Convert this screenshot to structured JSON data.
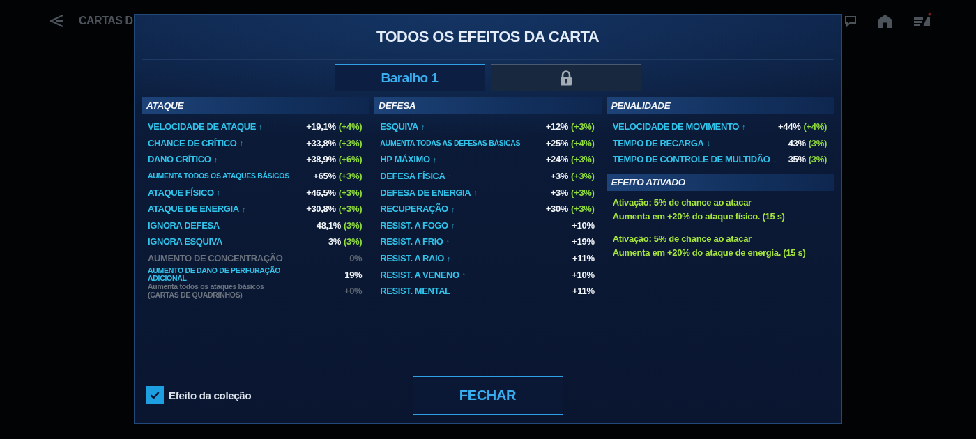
{
  "background": {
    "title": "CARTAS D"
  },
  "dialog": {
    "title": "TODOS OS EFEITOS DA CARTA",
    "tabs": [
      {
        "label": "Baralho 1",
        "selected": true,
        "locked": false
      },
      {
        "selected": false,
        "locked": true
      }
    ],
    "columns": [
      {
        "sections": [
          {
            "kind": "stats",
            "title": "ATAQUE",
            "stats": [
              {
                "label": "VELOCIDADE DE ATAQUE",
                "arrow": "↑",
                "value": "+19,1%",
                "bonus": "(+4%)",
                "kind": "regular",
                "disabled": false
              },
              {
                "label": "CHANCE DE CRÍTICO",
                "arrow": "↑",
                "value": "+33,8%",
                "bonus": "(+3%)",
                "kind": "regular",
                "disabled": false
              },
              {
                "label": "DANO CRÍTICO",
                "arrow": "↑",
                "value": "+38,9%",
                "bonus": "(+6%)",
                "kind": "regular",
                "disabled": false
              },
              {
                "label": "AUMENTA TODOS OS ATAQUES BÁSICOS",
                "value": "+65%",
                "bonus": "(+3%)",
                "kind": "compact",
                "disabled": false
              },
              {
                "label": "ATAQUE FÍSICO",
                "arrow": "↑",
                "value": "+46,5%",
                "bonus": "(+3%)",
                "kind": "regular",
                "disabled": false
              },
              {
                "label": "ATAQUE DE ENERGIA",
                "arrow": "↑",
                "value": "+30,8%",
                "bonus": "(+3%)",
                "kind": "regular",
                "disabled": false
              },
              {
                "label": "IGNORA DEFESA",
                "value": "48,1%",
                "bonus": "(3%)",
                "kind": "regular",
                "disabled": false
              },
              {
                "label": "IGNORA ESQUIVA",
                "value": "3%",
                "bonus": "(3%)",
                "kind": "regular",
                "disabled": false
              },
              {
                "label": "AUMENTO DE CONCENTRAÇÃO",
                "value": "0%",
                "kind": "regular",
                "disabled": true
              },
              {
                "label": "AUMENTO DE DANO DE PERFURAÇÃO ADICIONAL",
                "value": "19%",
                "kind": "compact",
                "disabled": false
              },
              {
                "label": "Aumenta todos os ataques básicos (CARTAS DE QUADRINHOS)",
                "value": "+0%",
                "kind": "compact",
                "disabled": true
              }
            ]
          }
        ]
      },
      {
        "sections": [
          {
            "kind": "stats",
            "title": "DEFESA",
            "stats": [
              {
                "label": "ESQUIVA",
                "arrow": "↑",
                "value": "+12%",
                "bonus": "(+3%)",
                "kind": "regular",
                "disabled": false
              },
              {
                "label": "AUMENTA TODAS AS DEFESAS BÁSICAS",
                "value": "+25%",
                "bonus": "(+4%)",
                "kind": "compact",
                "disabled": false
              },
              {
                "label": "HP MÁXIMO",
                "arrow": "↑",
                "value": "+24%",
                "bonus": "(+3%)",
                "kind": "regular",
                "disabled": false
              },
              {
                "label": "DEFESA FÍSICA",
                "arrow": "↑",
                "value": "+3%",
                "bonus": "(+3%)",
                "kind": "regular",
                "disabled": false
              },
              {
                "label": "DEFESA DE ENERGIA",
                "arrow": "↑",
                "value": "+3%",
                "bonus": "(+3%)",
                "kind": "regular",
                "disabled": false
              },
              {
                "label": "RECUPERAÇÃO",
                "arrow": "↑",
                "value": "+30%",
                "bonus": "(+3%)",
                "kind": "regular",
                "disabled": false
              },
              {
                "label": "RESIST. A FOGO",
                "arrow": "↑",
                "value": "+10%",
                "kind": "regular",
                "disabled": false
              },
              {
                "label": "RESIST. A FRIO",
                "arrow": "↑",
                "value": "+19%",
                "kind": "regular",
                "disabled": false
              },
              {
                "label": "RESIST. A RAIO",
                "arrow": "↑",
                "value": "+11%",
                "kind": "regular",
                "disabled": false
              },
              {
                "label": "RESIST. A VENENO",
                "arrow": "↑",
                "value": "+10%",
                "kind": "regular",
                "disabled": false
              },
              {
                "label": "RESIST. MENTAL",
                "arrow": "↑",
                "value": "+11%",
                "kind": "regular",
                "disabled": false
              }
            ]
          }
        ]
      },
      {
        "sections": [
          {
            "kind": "stats",
            "title": "PENALIDADE",
            "stats": [
              {
                "label": "VELOCIDADE DE MOVIMENTO",
                "arrow": "↑",
                "value": "+44%",
                "bonus": "(+4%)",
                "kind": "regular",
                "disabled": false
              },
              {
                "label": "TEMPO DE RECARGA",
                "arrow": "↓",
                "value": "43%",
                "bonus": "(3%)",
                "kind": "regular",
                "disabled": false
              },
              {
                "label": "TEMPO DE CONTROLE DE MULTIDÃO",
                "arrow": "↓",
                "value": "35%",
                "bonus": "(3%)",
                "kind": "regular",
                "disabled": false
              }
            ]
          },
          {
            "kind": "effects",
            "title": "EFEITO ATIVADO",
            "effects": [
              {
                "trigger": "Ativação: 5% de chance ao atacar",
                "result": "Aumenta em +20% do ataque físico. (15 s)"
              },
              {
                "trigger": "Ativação: 5% de chance ao atacar",
                "result": "Aumenta em +20% do ataque de energia. (15 s)"
              }
            ]
          }
        ]
      }
    ],
    "collection_effect": {
      "label": "Efeito da coleção",
      "checked": true
    },
    "close_button": {
      "label": "FECHAR"
    }
  }
}
